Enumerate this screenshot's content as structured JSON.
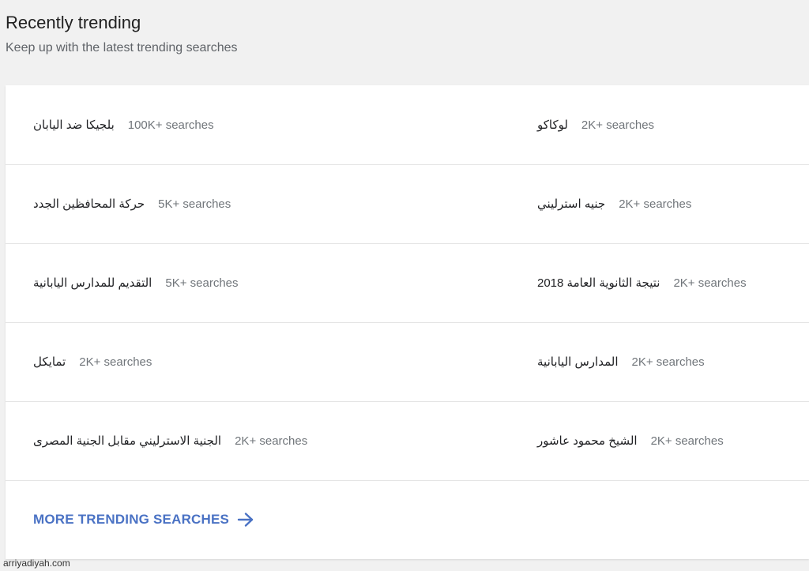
{
  "header": {
    "title": "Recently trending",
    "subtitle": "Keep up with the latest trending searches"
  },
  "trending": {
    "rows": [
      {
        "left": {
          "term": "بلجيكا ضد اليابان",
          "count": "100K+ searches"
        },
        "right": {
          "term": "لوكاكو",
          "count": "2K+ searches"
        }
      },
      {
        "left": {
          "term": "حركة المحافظين الجدد",
          "count": "5K+ searches"
        },
        "right": {
          "term": "جنيه استرليني",
          "count": "2K+ searches"
        }
      },
      {
        "left": {
          "term": "التقديم للمدارس اليابانية",
          "count": "5K+ searches"
        },
        "right": {
          "term": "نتيجة الثانوية العامة 2018",
          "count": "2K+ searches"
        }
      },
      {
        "left": {
          "term": "تمايكل",
          "count": "2K+ searches"
        },
        "right": {
          "term": "المدارس اليابانية",
          "count": "2K+ searches"
        }
      },
      {
        "left": {
          "term": "الجنية الاسترليني مقابل الجنية المصرى",
          "count": "2K+ searches"
        },
        "right": {
          "term": "الشيخ محمود عاشور",
          "count": "2K+ searches"
        }
      }
    ],
    "more_label": "MORE TRENDING SEARCHES",
    "more_icon": "arrow-right-icon"
  },
  "watermark": "arriyadiyah.com",
  "colors": {
    "link": "#4a72c4",
    "background": "#f1f1f1",
    "card": "#ffffff"
  }
}
